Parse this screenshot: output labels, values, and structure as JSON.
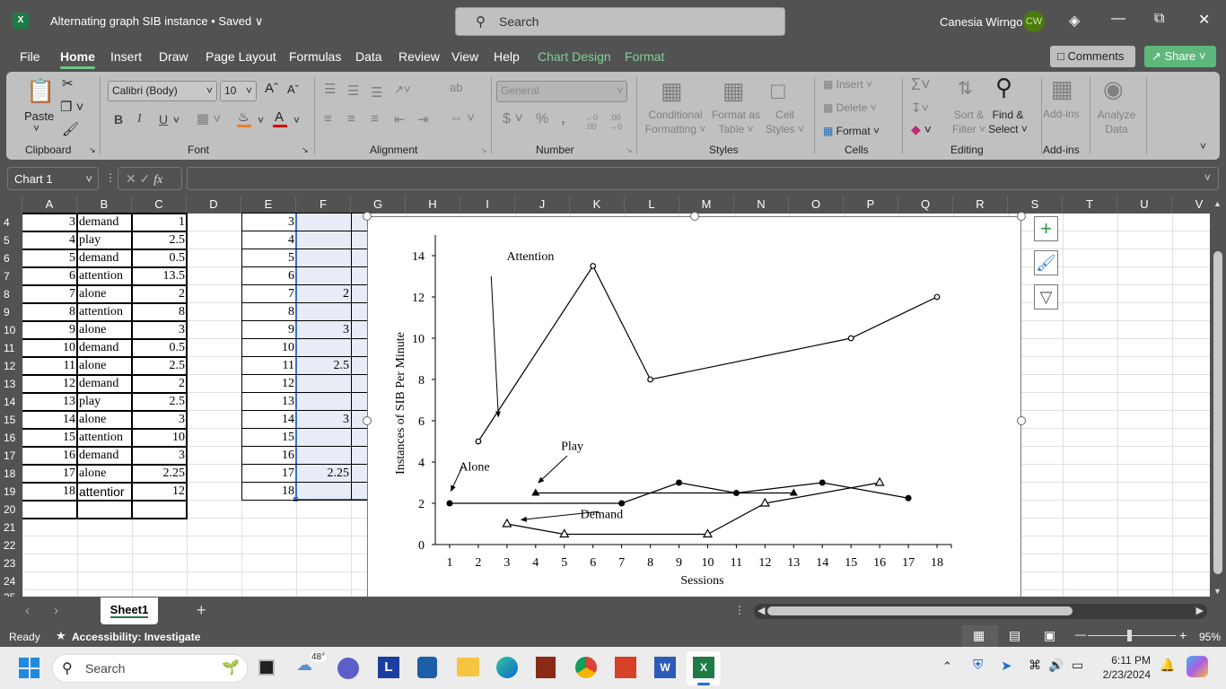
{
  "titlebar": {
    "app_icon": "excel-icon",
    "document_title": "Alternating graph SIB instance • Saved ∨",
    "search_placeholder": "Search",
    "user_name": "Canesia Wirngo",
    "user_initials": "CW",
    "premium_icon": "diamond-icon",
    "minimize": "—",
    "restore": "⧉",
    "close": "✕"
  },
  "menu": {
    "items": [
      "File",
      "Home",
      "Insert",
      "Draw",
      "Page Layout",
      "Formulas",
      "Data",
      "Review",
      "View",
      "Help"
    ],
    "context_items": [
      "Chart Design",
      "Format"
    ],
    "active": "Home",
    "comments_label": "Comments",
    "share_label": "Share"
  },
  "ribbon": {
    "clipboard": {
      "paste": "Paste",
      "group": "Clipboard"
    },
    "font": {
      "font_name": "Calibri (Body)",
      "font_size": "10",
      "bold": "B",
      "italic": "I",
      "underline": "U",
      "group": "Font",
      "fill_color": "#ed7d31",
      "font_color": "#e00000"
    },
    "alignment": {
      "group": "Alignment"
    },
    "number": {
      "format": "General",
      "currency": "$",
      "percent": "%",
      "comma": "̹",
      "group": "Number"
    },
    "styles": {
      "conditional": [
        "Conditional",
        "Formatting ˅"
      ],
      "format_table": [
        "Format as",
        "Table ˅"
      ],
      "cell_styles": [
        "Cell",
        "Styles ˅"
      ],
      "group": "Styles"
    },
    "cells": {
      "insert": "Insert",
      "delete": "Delete",
      "format": "Format",
      "group": "Cells"
    },
    "editing": {
      "sort": [
        "Sort &",
        "Filter ˅"
      ],
      "find": [
        "Find &",
        "Select ˅"
      ],
      "group": "Editing"
    },
    "addins": {
      "label": "Add-ins",
      "group": "Add-ins"
    },
    "analyze": {
      "label": [
        "Analyze",
        "Data"
      ]
    }
  },
  "formula_bar": {
    "name_box": "Chart 1",
    "fx": "fx",
    "value": ""
  },
  "sheet": {
    "columns": [
      "A",
      "B",
      "C",
      "D",
      "E",
      "F",
      "G",
      "H",
      "I",
      "J",
      "K",
      "L",
      "M",
      "N",
      "O",
      "P",
      "Q",
      "R",
      "S",
      "T",
      "U",
      "V"
    ],
    "row_numbers": [
      "4",
      "5",
      "6",
      "7",
      "8",
      "9",
      "10",
      "11",
      "12",
      "13",
      "14",
      "15",
      "16",
      "17",
      "18",
      "19",
      "20",
      "21",
      "22",
      "23",
      "24",
      "25"
    ],
    "table_abc": [
      [
        "3",
        "demand",
        "1"
      ],
      [
        "4",
        "play",
        "2.5"
      ],
      [
        "5",
        "demand",
        "0.5"
      ],
      [
        "6",
        "attention",
        "13.5"
      ],
      [
        "7",
        "alone",
        "2"
      ],
      [
        "8",
        "attention",
        "8"
      ],
      [
        "9",
        "alone",
        "3"
      ],
      [
        "10",
        "demand",
        "0.5"
      ],
      [
        "11",
        "alone",
        "2.5"
      ],
      [
        "12",
        "demand",
        "2"
      ],
      [
        "13",
        "play",
        "2.5"
      ],
      [
        "14",
        "alone",
        "3"
      ],
      [
        "15",
        "attention",
        "10"
      ],
      [
        "16",
        "demand",
        "3"
      ],
      [
        "17",
        "alone",
        "2.25"
      ],
      [
        "18",
        "attentior",
        "12"
      ]
    ],
    "table_ef": [
      [
        "3",
        ""
      ],
      [
        "4",
        ""
      ],
      [
        "5",
        ""
      ],
      [
        "6",
        ""
      ],
      [
        "7",
        "2"
      ],
      [
        "8",
        ""
      ],
      [
        "9",
        "3"
      ],
      [
        "10",
        ""
      ],
      [
        "11",
        "2.5"
      ],
      [
        "12",
        ""
      ],
      [
        "13",
        ""
      ],
      [
        "14",
        "3"
      ],
      [
        "15",
        ""
      ],
      [
        "16",
        ""
      ],
      [
        "17",
        "2.25"
      ],
      [
        "18",
        ""
      ]
    ]
  },
  "chart_data": {
    "type": "line",
    "title": "",
    "xlabel": "Sessions",
    "ylabel": "Instances of SIB Per Minute",
    "x_ticks": [
      "1",
      "2",
      "3",
      "4",
      "5",
      "6",
      "7",
      "8",
      "9",
      "10",
      "11",
      "12",
      "13",
      "14",
      "15",
      "16",
      "17",
      "18"
    ],
    "y_ticks": [
      "0",
      "2",
      "4",
      "6",
      "8",
      "10",
      "12",
      "14"
    ],
    "xlim": [
      0.5,
      18.5
    ],
    "ylim": [
      0,
      15
    ],
    "grid": false,
    "legend": "none (inline annotations with arrows)",
    "series": [
      {
        "name": "Attention",
        "marker": "open-circle",
        "points": [
          [
            2,
            5
          ],
          [
            6,
            13.5
          ],
          [
            8,
            8
          ],
          [
            15,
            10
          ],
          [
            18,
            12
          ]
        ]
      },
      {
        "name": "Alone",
        "marker": "filled-circle",
        "points": [
          [
            1,
            2
          ],
          [
            7,
            2
          ],
          [
            9,
            3
          ],
          [
            11,
            2.5
          ],
          [
            14,
            3
          ],
          [
            17,
            2.25
          ]
        ]
      },
      {
        "name": "Play",
        "marker": "filled-triangle",
        "points": [
          [
            4,
            2.5
          ],
          [
            13,
            2.5
          ]
        ]
      },
      {
        "name": "Demand",
        "marker": "open-triangle",
        "points": [
          [
            3,
            1
          ],
          [
            5,
            0.5
          ],
          [
            10,
            0.5
          ],
          [
            12,
            2
          ],
          [
            16,
            3
          ]
        ]
      }
    ],
    "annotations": [
      {
        "text": "Attention",
        "at": [
          3.3,
          14
        ],
        "arrow_to": [
          2.7,
          6.2
        ]
      },
      {
        "text": "Alone",
        "at": [
          1.7,
          3.8
        ],
        "arrow_to": [
          1.05,
          2.6
        ]
      },
      {
        "text": "Play",
        "at": [
          5.2,
          4.8
        ],
        "arrow_to": [
          4.1,
          3
        ]
      },
      {
        "text": "Demand",
        "at": [
          6.5,
          1.5
        ],
        "arrow_to": [
          3.5,
          1.2
        ]
      }
    ]
  },
  "chart_tools": [
    "chart-elements-plus-icon",
    "chart-styles-brush-icon",
    "chart-filter-icon"
  ],
  "sheet_tabs": {
    "tabs": [
      "Sheet1"
    ],
    "active": "Sheet1",
    "add": "+"
  },
  "statusbar": {
    "ready": "Ready",
    "accessibility": "Accessibility: Investigate",
    "zoom": "95%",
    "zoom_fraction": 0.45
  },
  "taskbar": {
    "search_placeholder": "Search",
    "weather": "48°",
    "time": "6:11 PM",
    "date": "2/23/2024"
  }
}
